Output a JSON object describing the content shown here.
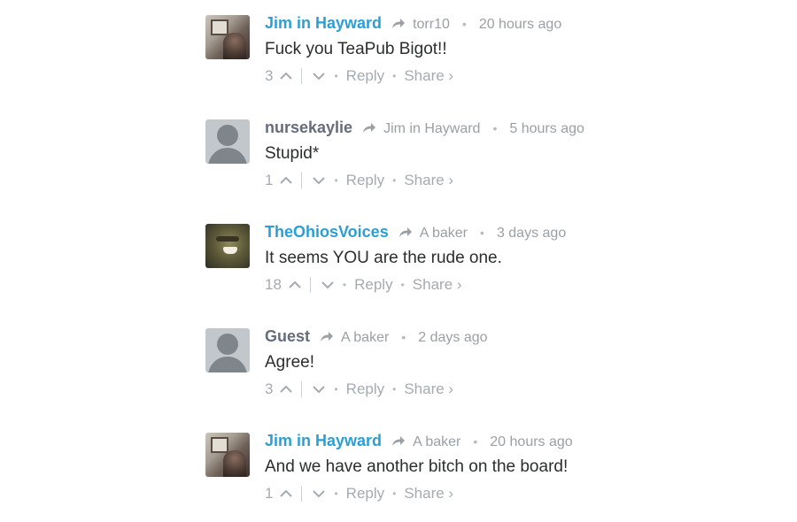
{
  "comments": [
    {
      "author": "Jim in Hayward",
      "author_style": "linked",
      "avatar": "photo-room",
      "reply_to": "torr10",
      "time": "20 hours ago",
      "text": "Fuck you TeaPub Bigot!!",
      "votes": "3",
      "reply_label": "Reply",
      "share_label": "Share ›"
    },
    {
      "author": "nursekaylie",
      "author_style": "plain",
      "avatar": "default",
      "reply_to": "Jim in Hayward",
      "time": "5 hours ago",
      "text": "Stupid*",
      "votes": "1",
      "reply_label": "Reply",
      "share_label": "Share ›"
    },
    {
      "author": "TheOhiosVoices",
      "author_style": "linked",
      "avatar": "photo-orc",
      "reply_to": "A baker",
      "time": "3 days ago",
      "text": "It seems YOU are the rude one.",
      "votes": "18",
      "reply_label": "Reply",
      "share_label": "Share ›"
    },
    {
      "author": "Guest",
      "author_style": "plain",
      "avatar": "default",
      "reply_to": "A baker",
      "time": "2 days ago",
      "text": "Agree!",
      "votes": "3",
      "reply_label": "Reply",
      "share_label": "Share ›"
    },
    {
      "author": "Jim in Hayward",
      "author_style": "linked",
      "avatar": "photo-room",
      "reply_to": "A baker",
      "time": "20 hours ago",
      "text": "And we have another bitch on the board!",
      "votes": "1",
      "reply_label": "Reply",
      "share_label": "Share ›"
    }
  ],
  "icons": {
    "reply_arrow": "reply-arrow-icon",
    "upvote": "chevron-up-icon",
    "downvote": "chevron-down-icon"
  },
  "colors": {
    "author_link": "#2a9fd6",
    "author_plain": "#656c7a",
    "meta_gray": "#9aa0a6",
    "comment_text": "#2a2e2e"
  }
}
